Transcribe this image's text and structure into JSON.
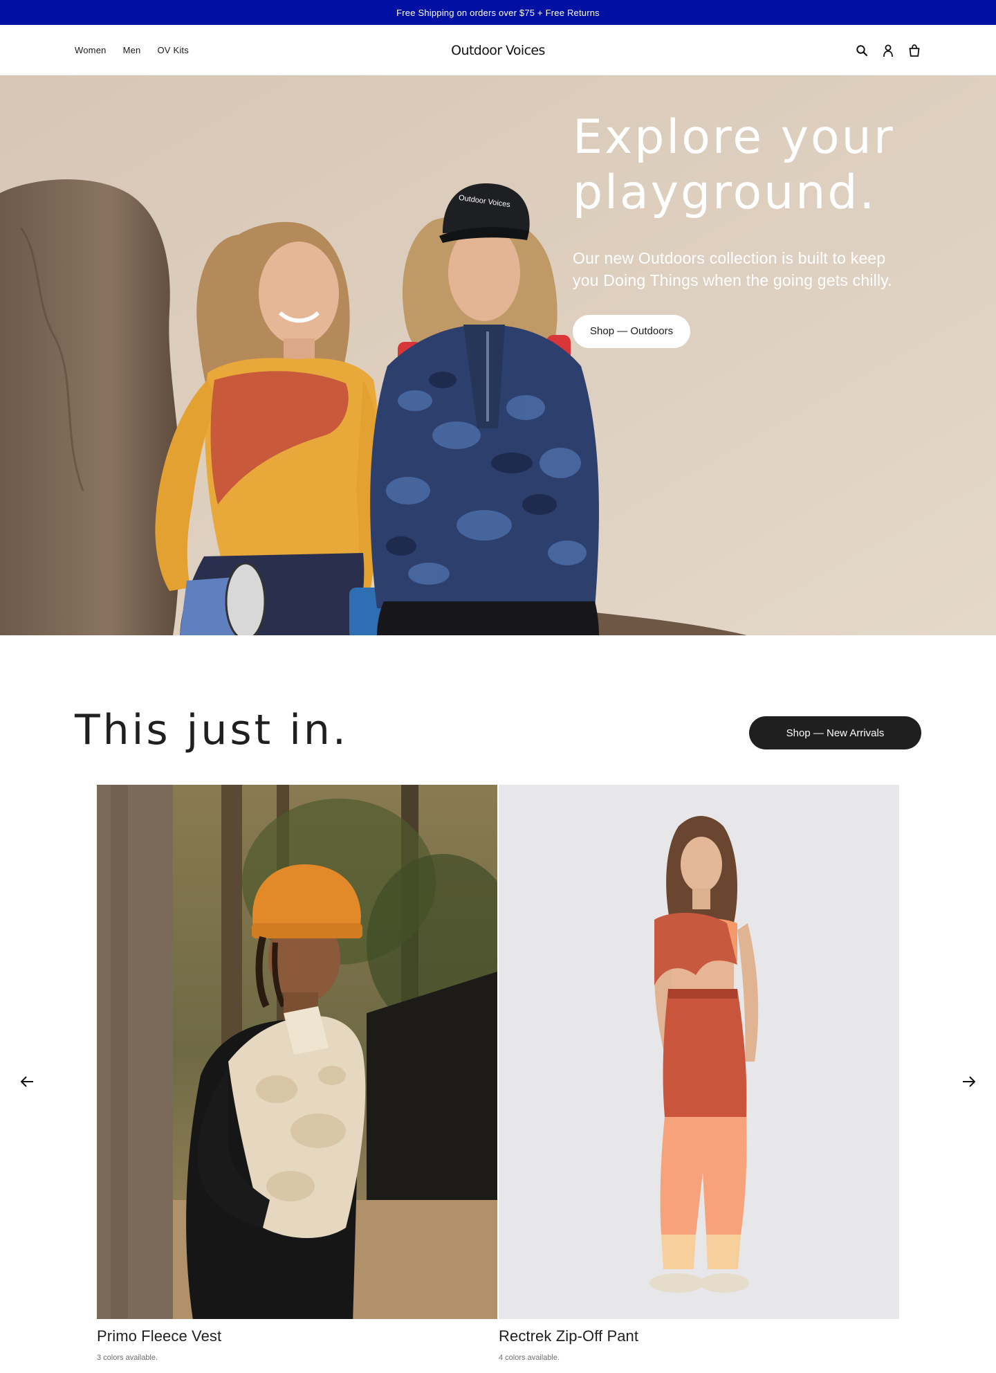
{
  "announcement": "Free Shipping on orders over $75 + Free Returns",
  "header": {
    "nav": [
      "Women",
      "Men",
      "OV Kits"
    ],
    "logo": "Outdoor Voices",
    "icons": [
      "search-icon",
      "account-icon",
      "bag-icon"
    ]
  },
  "hero": {
    "title_line1": "Explore your",
    "title_line2": "playground.",
    "subtitle_line1": "Our new Outdoors collection is built to keep",
    "subtitle_line2": "you Doing Things when the going gets chilly.",
    "button": "Shop — Outdoors",
    "cap_text": "Outdoor Voices"
  },
  "new_arrivals": {
    "title": "This just in.",
    "button": "Shop — New Arrivals",
    "products": [
      {
        "name": "Primo Fleece Vest",
        "colors": "3 colors available."
      },
      {
        "name": "Rectrek Zip-Off Pant",
        "colors": "4 colors available."
      }
    ],
    "arrows": [
      "arrow-left-icon",
      "arrow-right-icon"
    ]
  },
  "colors": {
    "announcement_bg": "#0010a3",
    "button_dark": "#1f1f1f",
    "hero_bg": "#dccdbd"
  }
}
